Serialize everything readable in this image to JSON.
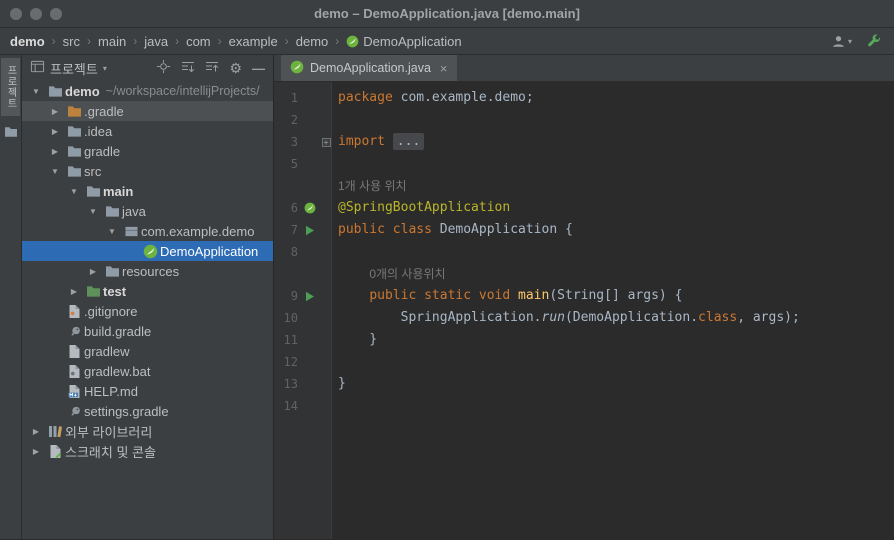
{
  "window": {
    "title": "demo – DemoApplication.java [demo.main]"
  },
  "breadcrumbs": {
    "separator": "›",
    "items": [
      "demo",
      "src",
      "main",
      "java",
      "com",
      "example",
      "demo",
      "DemoApplication"
    ]
  },
  "topbar_icons": {
    "user": "user-icon",
    "build": "wrench-icon"
  },
  "stripe": {
    "project_tab": "프로젝트"
  },
  "project_panel": {
    "header": {
      "title": "프로젝트",
      "icons": [
        "project-view-icon",
        "locate-icon",
        "expand-all-icon",
        "collapse-all-icon",
        "settings-gear-icon",
        "hide-icon"
      ]
    },
    "tree": [
      {
        "label": "demo",
        "suffix": "~/workspace/intellijProjects/",
        "icon": "folder-icon",
        "level": 0,
        "arrow": "open",
        "bold": true
      },
      {
        "label": ".gradle",
        "icon": "gradle-folder-icon",
        "level": 1,
        "arrow": "closed",
        "hover": true
      },
      {
        "label": ".idea",
        "icon": "folder-icon",
        "level": 1,
        "arrow": "closed"
      },
      {
        "label": "gradle",
        "icon": "folder-icon",
        "level": 1,
        "arrow": "closed"
      },
      {
        "label": "src",
        "icon": "folder-icon",
        "level": 1,
        "arrow": "open"
      },
      {
        "label": "main",
        "icon": "folder-icon",
        "level": 2,
        "arrow": "open",
        "bold": true
      },
      {
        "label": "java",
        "icon": "folder-icon",
        "level": 3,
        "arrow": "open"
      },
      {
        "label": "com.example.demo",
        "icon": "package-icon",
        "level": 4,
        "arrow": "open"
      },
      {
        "label": "DemoApplication",
        "icon": "spring-icon",
        "level": 5,
        "arrow": "none",
        "selected": true
      },
      {
        "label": "resources",
        "icon": "folder-icon",
        "level": 3,
        "arrow": "closed"
      },
      {
        "label": "test",
        "icon": "test-folder-icon",
        "level": 2,
        "arrow": "closed",
        "bold": true
      },
      {
        "label": ".gitignore",
        "icon": "git-file-icon",
        "level": 1,
        "arrow": "none"
      },
      {
        "label": "build.gradle",
        "icon": "gradle-icon",
        "level": 1,
        "arrow": "none"
      },
      {
        "label": "gradlew",
        "icon": "file-icon",
        "level": 1,
        "arrow": "none"
      },
      {
        "label": "gradlew.bat",
        "icon": "bat-file-icon",
        "level": 1,
        "arrow": "none"
      },
      {
        "label": "HELP.md",
        "icon": "markdown-icon",
        "level": 1,
        "arrow": "none"
      },
      {
        "label": "settings.gradle",
        "icon": "gradle-icon",
        "level": 1,
        "arrow": "none"
      },
      {
        "label": "외부 라이브러리",
        "icon": "library-icon",
        "level": 0,
        "arrow": "closed"
      },
      {
        "label": "스크래치 및 콘솔",
        "icon": "scratch-icon",
        "level": 0,
        "arrow": "closed"
      }
    ]
  },
  "editor": {
    "tab": {
      "label": "DemoApplication.java",
      "icon": "spring-icon",
      "close": "×"
    },
    "lines": [
      {
        "num": "1",
        "tokens": [
          {
            "t": "package ",
            "s": "kw"
          },
          {
            "t": "com.example.demo;",
            "s": "pl"
          }
        ]
      },
      {
        "num": "2",
        "tokens": []
      },
      {
        "num": "3",
        "fold": "plus",
        "tokens": [
          {
            "t": "import ",
            "s": "kw"
          },
          {
            "t": "...",
            "s": "fold"
          }
        ]
      },
      {
        "num": "5",
        "tokens": []
      },
      {
        "num": "",
        "tokens": [
          {
            "t": "1개 사용 위치",
            "s": "hint"
          }
        ]
      },
      {
        "num": "6",
        "gutter": "spring",
        "tokens": [
          {
            "t": "@SpringBootApplication",
            "s": "ann"
          }
        ]
      },
      {
        "num": "7",
        "gutter": "run",
        "tokens": [
          {
            "t": "public class ",
            "s": "kw"
          },
          {
            "t": "DemoApplication {",
            "s": "pl"
          }
        ]
      },
      {
        "num": "8",
        "tokens": []
      },
      {
        "num": "",
        "tokens": [
          {
            "t": "    ",
            "s": "pl"
          },
          {
            "t": "0개의 사용위치",
            "s": "hint"
          }
        ]
      },
      {
        "num": "9",
        "gutter": "run",
        "tokens": [
          {
            "t": "    ",
            "s": "pl"
          },
          {
            "t": "public static void ",
            "s": "kw"
          },
          {
            "t": "main",
            "s": "mth"
          },
          {
            "t": "(String[] args) {",
            "s": "pl"
          }
        ]
      },
      {
        "num": "10",
        "tokens": [
          {
            "t": "        SpringApplication.",
            "s": "pl"
          },
          {
            "t": "run",
            "s": "itl"
          },
          {
            "t": "(DemoApplication.",
            "s": "pl"
          },
          {
            "t": "class",
            "s": "kw"
          },
          {
            "t": ", args);",
            "s": "pl"
          }
        ]
      },
      {
        "num": "11",
        "tokens": [
          {
            "t": "    }",
            "s": "pl"
          }
        ]
      },
      {
        "num": "12",
        "tokens": []
      },
      {
        "num": "13",
        "tokens": [
          {
            "t": "}",
            "s": "pl"
          }
        ]
      },
      {
        "num": "14",
        "tokens": []
      }
    ]
  },
  "colors": {
    "keyword": "#cc7832",
    "annotation": "#bbb529",
    "method": "#ffc66b",
    "plain_text": "#a9b7c6",
    "usage_hint": "#787878",
    "selection_blue": "#2d6cb5",
    "spring_green": "#6db33f",
    "run_green": "#4b9e53",
    "editor_bg": "#2b2b2b",
    "panel_bg": "#3c3f41"
  }
}
